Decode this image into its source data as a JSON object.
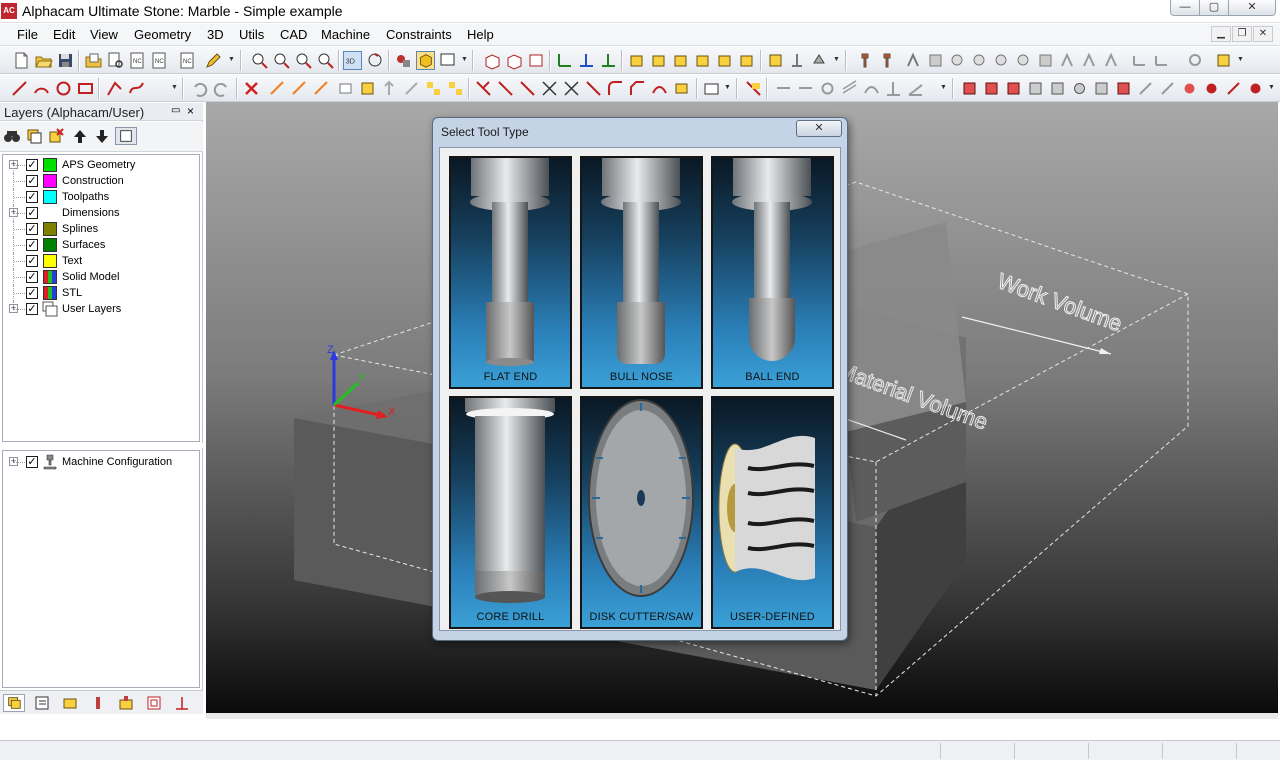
{
  "window": {
    "app_icon": "AC",
    "title": "Alphacam Ultimate Stone: Marble - Simple example",
    "minimize_icon": "—",
    "maximize_icon": "▢",
    "close_icon": "✕"
  },
  "menu": {
    "items": [
      "File",
      "Edit",
      "View",
      "Geometry",
      "3D",
      "Utils",
      "CAD",
      "Machine",
      "Constraints",
      "Help"
    ]
  },
  "layers_panel": {
    "title": "Layers (Alphacam/User)",
    "pin_icon": "▭",
    "close_icon": "×",
    "layers": [
      {
        "name": "APS Geometry",
        "color": "#00e000",
        "expandable": true
      },
      {
        "name": "Construction",
        "color": "#ff00ff",
        "expandable": false
      },
      {
        "name": "Toolpaths",
        "color": "#00ffff",
        "expandable": false
      },
      {
        "name": "Dimensions",
        "color": "",
        "expandable": true
      },
      {
        "name": "Splines",
        "color": "#808000",
        "expandable": false
      },
      {
        "name": "Surfaces",
        "color": "#008000",
        "expandable": false
      },
      {
        "name": "Text",
        "color": "#ffff00",
        "expandable": false
      },
      {
        "name": "Solid Model",
        "color": "multi",
        "expandable": false
      },
      {
        "name": "STL",
        "color": "multi",
        "expandable": false
      },
      {
        "name": "User Layers",
        "color": "",
        "expandable": true
      }
    ],
    "check_mark": "✓"
  },
  "machine_panel": {
    "item": "Machine Configuration",
    "check_mark": "✓"
  },
  "viewport": {
    "text_work_volume": "Work Volume",
    "text_material_vol": "Material Volume",
    "axis_z": "Z",
    "axis_x": "X",
    "axis_y": "Y",
    "colors": {
      "z_axis": "#2a3ae0",
      "x_axis": "#e02020",
      "y_axis": "#22c022"
    }
  },
  "dialog": {
    "title": "Select Tool Type",
    "close_icon": "✕",
    "tools": [
      {
        "label": "FLAT END",
        "icon": "flat-end-tool-icon"
      },
      {
        "label": "BULL NOSE",
        "icon": "bull-nose-tool-icon"
      },
      {
        "label": "BALL END",
        "icon": "ball-end-tool-icon"
      },
      {
        "label": "CORE DRILL",
        "icon": "core-drill-tool-icon"
      },
      {
        "label": "DISK CUTTER/SAW",
        "icon": "disk-saw-tool-icon"
      },
      {
        "label": "USER-DEFINED",
        "icon": "user-defined-tool-icon"
      }
    ]
  }
}
